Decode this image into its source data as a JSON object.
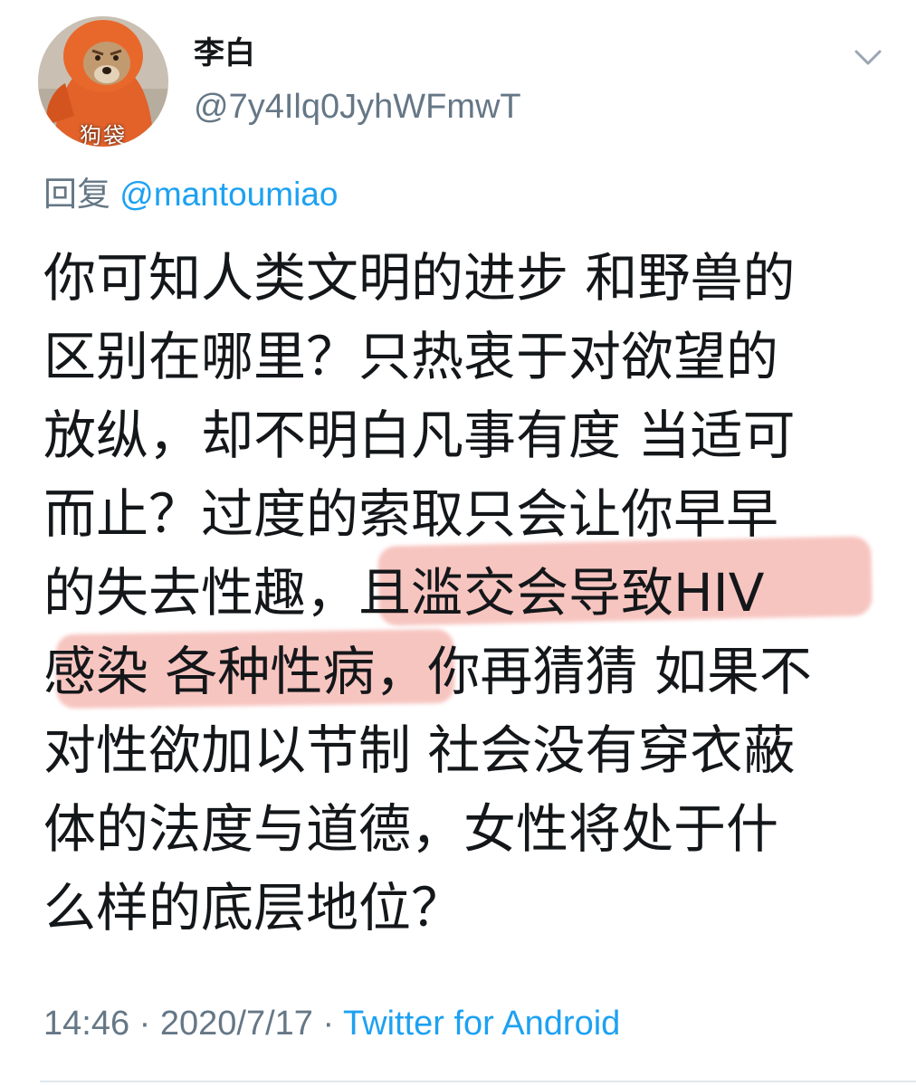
{
  "tweet": {
    "author": {
      "display_name": "李白",
      "username": "@7y4Ilq0JyhWFmwT",
      "avatar_caption": "狗袋"
    },
    "reply_to": {
      "prefix": "回复",
      "handle": "@mantoumiao"
    },
    "body_lines": [
      "你可知人类文明的进步 和野兽的",
      "区别在哪里？只热衷于对欲望的",
      "放纵，却不明白凡事有度 当适可",
      "而止？过度的索取只会让你早早",
      "的失去性趣，且滥交会导致HIV",
      "感染 各种性病，你再猜猜 如果不",
      "对性欲加以节制 社会没有穿衣蔽",
      "体的法度与道德，女性将处于什",
      "么样的底层地位？"
    ],
    "highlighted_phrases": [
      "且滥交会导致HIV",
      "感染 各种性病，"
    ],
    "meta": {
      "time": "14:46",
      "separator": "·",
      "date": "2020/7/17",
      "source": "Twitter for Android"
    }
  },
  "icons": {
    "menu": "chevron-down-icon"
  },
  "colors": {
    "text_primary": "#14171a",
    "text_secondary": "#657786",
    "link": "#1da1f2",
    "highlight": "#f0968c",
    "divider": "#e1e8ed",
    "background": "#ffffff"
  }
}
